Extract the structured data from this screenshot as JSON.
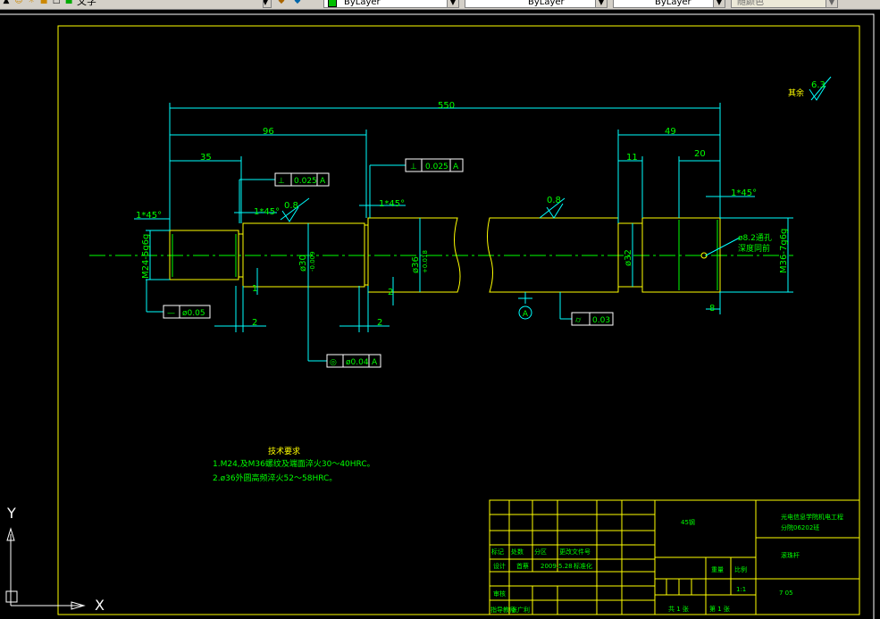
{
  "toolbar": {
    "text_style_value": "文字",
    "layer_color_value": "ByLayer",
    "linetype_value": "ByLayer",
    "lineweight_value": "ByLayer",
    "plot_style_value": "随颜色"
  },
  "drawing": {
    "dimensions": {
      "overall_length": "550",
      "len_96": "96",
      "len_35": "35",
      "len_49": "49",
      "len_11": "11",
      "len_20": "20",
      "chamfer_left": "1*45°",
      "chamfer_mid1": "1*45°",
      "chamfer_mid2": "1*45°",
      "chamfer_right": "1*45°",
      "groove_2a": "2",
      "groove_2b": "2",
      "groove_1": "1",
      "groove_2c": "2",
      "depth_8": "8",
      "dia_m24": "M24-5g6g",
      "dia_30": "ø30",
      "dia_30_tol": "-0.009",
      "dia_36": "ø36",
      "dia_36_tol": "+0.018",
      "dia_32": "ø32",
      "dia_m36": "M36-7g6g"
    },
    "tolerances": {
      "perp1_value": "0.025",
      "perp1_datum": "A",
      "perp2_value": "0.025",
      "perp2_datum": "A",
      "straight_value": "ø0.05",
      "coax_value": "ø0.04",
      "coax_datum": "A",
      "cyl_value": "0.03",
      "datum_label": "A"
    },
    "roughness": {
      "general_label": "其余",
      "general_value": "6.3",
      "r1": "0.8",
      "r2": "0.8"
    },
    "center_hole_note_1": "ø8.2通孔",
    "center_hole_note_2": "深度同前",
    "tech_requirements": {
      "title": "技术要求",
      "line1": "1.M24,及M36螺纹及端面淬火30～40HRC。",
      "line2": "2.ø36外圆高频淬火52～58HRC。"
    },
    "ucs": {
      "y_label": "Y",
      "x_label": "X"
    }
  },
  "title_block": {
    "material": "45钢",
    "org_line1": "光电信息学院机电工程",
    "org_line2": "分院06202班",
    "part_name": "滚珠杆",
    "row_labels": {
      "mark": "标记",
      "count": "处数",
      "zone": "分区",
      "change_doc": "更改文件号",
      "design": "设计",
      "designer": "首蔡",
      "date": "2009.5.28",
      "standardize": "标准化",
      "review": "审核",
      "approve": "指导教师",
      "approver": "张广利"
    },
    "weight_label": "重量",
    "scale_label": "比例",
    "scale_value": "1:1",
    "sheet_total": "共 1 张",
    "sheet_no": "第 1 张",
    "drawing_no": "7  05"
  }
}
